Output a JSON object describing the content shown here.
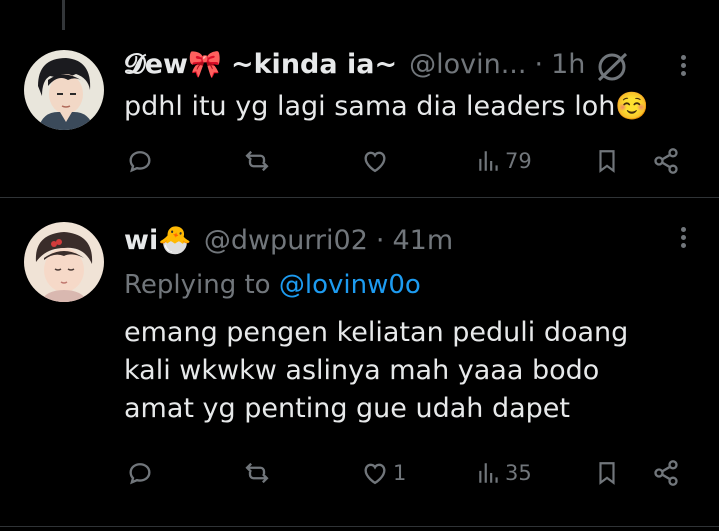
{
  "tweets": [
    {
      "name": "𝓓ew🎀 ~kinda ia~",
      "handle": "@lovin...",
      "time": "1h",
      "text": "pdhl itu yg lagi sama dia leaders loh☺️",
      "views": "79",
      "likes": ""
    },
    {
      "name": "wi🐣",
      "handle": "@dwpurri02",
      "time": "41m",
      "replying_label": "Replying to",
      "replying_to": "@lovinw0o",
      "text_lines": [
        "emang pengen keliatan peduli doang",
        "kali wkwkw aslinya mah yaaa bodo",
        "amat yg penting gue udah dapet"
      ],
      "likes": "1",
      "views": "35"
    }
  ],
  "colors": {
    "background": "#000000",
    "text": "#e7e9ea",
    "secondary": "#71767b",
    "link": "#1d9bf0",
    "divider": "#2f3336"
  },
  "icons": [
    "reply-icon",
    "retweet-icon",
    "like-icon",
    "views-icon",
    "bookmark-icon",
    "share-icon",
    "grok-icon",
    "more-icon"
  ]
}
